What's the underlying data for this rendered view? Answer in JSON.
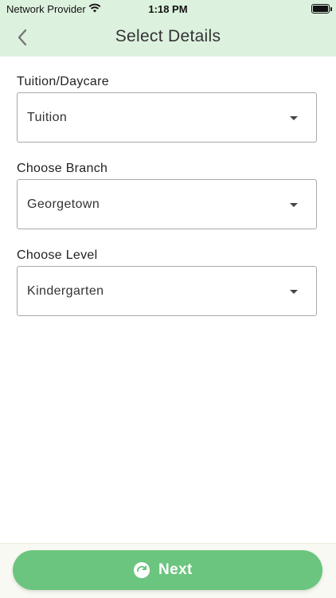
{
  "status_bar": {
    "carrier": "Network Provider",
    "time": "1:18 PM"
  },
  "header": {
    "title": "Select Details"
  },
  "form": {
    "fields": [
      {
        "label": "Tuition/Daycare",
        "value": "Tuition"
      },
      {
        "label": "Choose Branch",
        "value": "Georgetown"
      },
      {
        "label": "Choose Level",
        "value": "Kindergarten"
      }
    ]
  },
  "footer": {
    "next_label": "Next"
  },
  "colors": {
    "header_bg": "#ddf1df",
    "accent": "#6cc57e"
  },
  "icons": {
    "back": "chevron-left-icon",
    "next": "refresh-icon",
    "dropdown": "caret-down-icon"
  }
}
